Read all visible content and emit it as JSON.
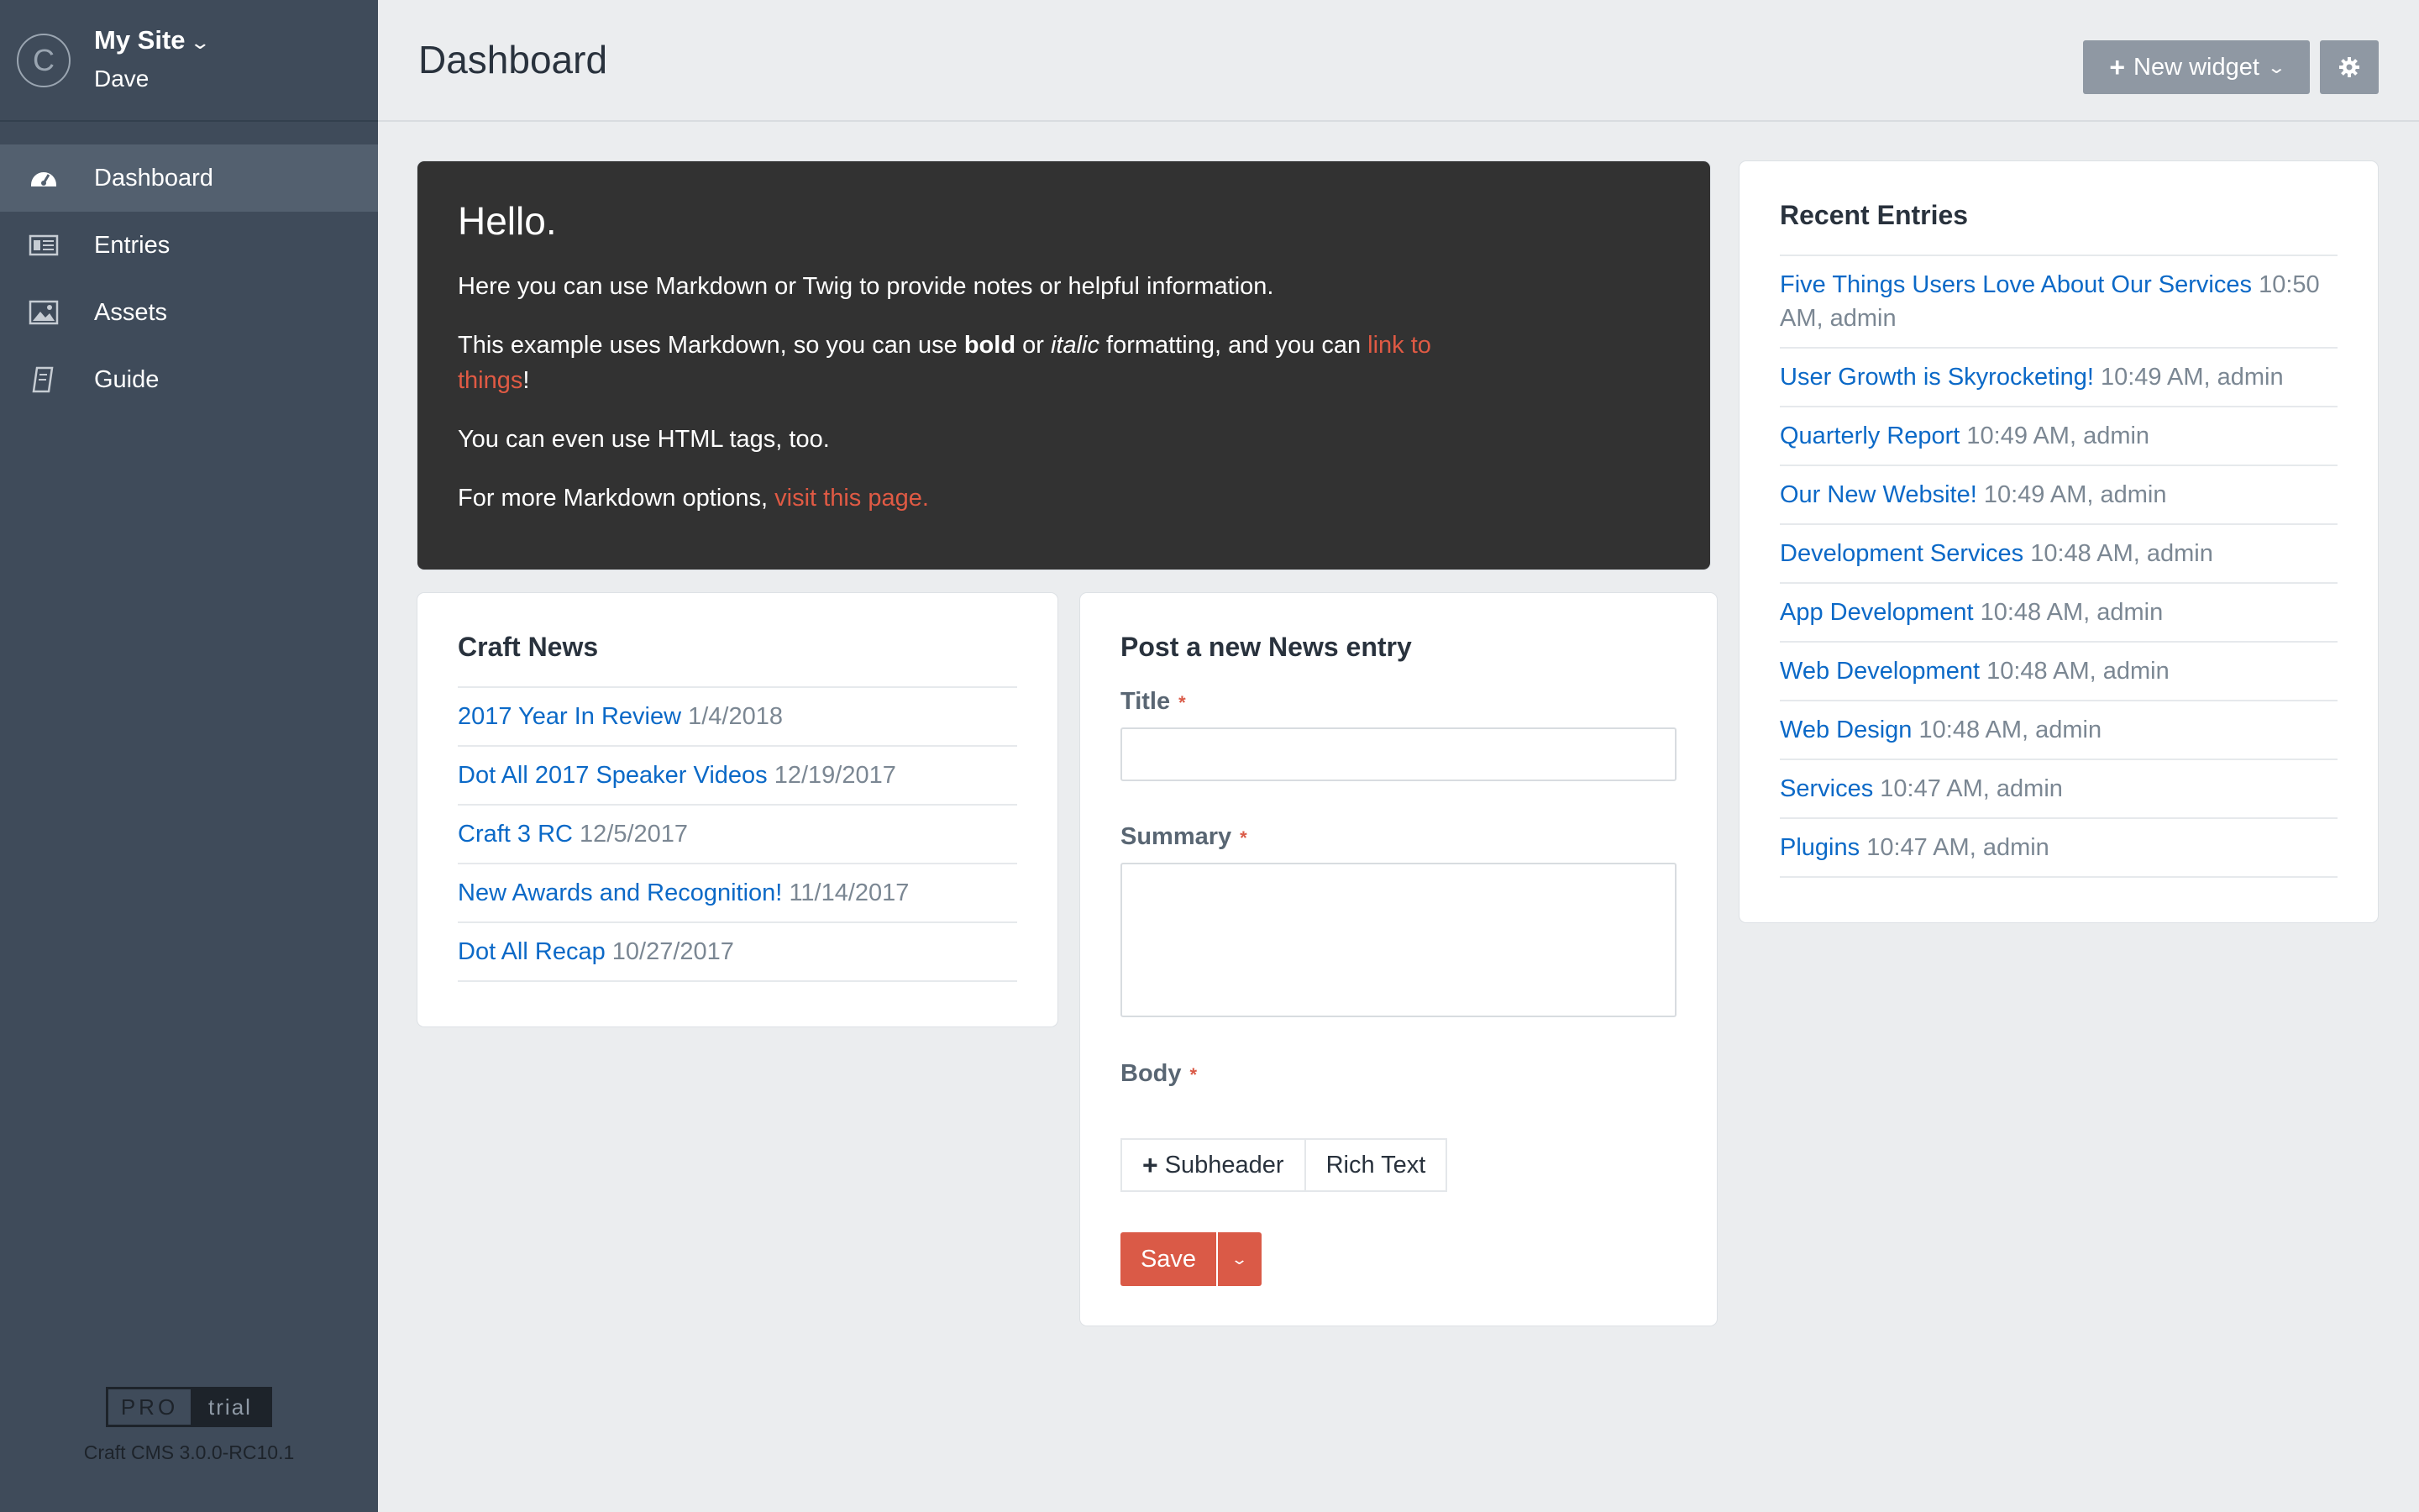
{
  "site": {
    "logo_letter": "C",
    "name": "My Site",
    "user": "Dave"
  },
  "nav": [
    {
      "label": "Dashboard",
      "icon": "dashboard-icon",
      "selected": true
    },
    {
      "label": "Entries",
      "icon": "entries-icon"
    },
    {
      "label": "Assets",
      "icon": "assets-icon"
    },
    {
      "label": "Guide",
      "icon": "guide-icon"
    }
  ],
  "edition": {
    "pro": "PRO",
    "trial": "trial",
    "version": "Craft CMS 3.0.0-RC10.1"
  },
  "header": {
    "title": "Dashboard",
    "new_widget_label": "New widget"
  },
  "hello_widget": {
    "heading": "Hello.",
    "p1": "Here you can use Markdown or Twig to provide notes or helpful information.",
    "p2_a": "This example uses Markdown, so you can use ",
    "p2_bold": "bold",
    "p2_or": " or ",
    "p2_italic": "italic",
    "p2_b": " formatting, and you can ",
    "p2_link": "link to things",
    "p2_end": "!",
    "p3": "You can even use HTML tags, too.",
    "p4_a": "For more Markdown options, ",
    "p4_link": "visit this page."
  },
  "craft_news": {
    "title": "Craft News",
    "items": [
      {
        "title": "2017 Year In Review",
        "date": "1/4/2018"
      },
      {
        "title": "Dot All 2017 Speaker Videos",
        "date": "12/19/2017"
      },
      {
        "title": "Craft 3 RC",
        "date": "12/5/2017"
      },
      {
        "title": "New Awards and Recognition!",
        "date": "11/14/2017"
      },
      {
        "title": "Dot All Recap",
        "date": "10/27/2017"
      }
    ]
  },
  "post_form": {
    "title": "Post a new News entry",
    "title_label": "Title",
    "summary_label": "Summary",
    "body_label": "Body",
    "required_mark": "*",
    "subheader_btn": "Subheader",
    "richtext_btn": "Rich Text",
    "save_label": "Save"
  },
  "recent_entries": {
    "title": "Recent Entries",
    "items": [
      {
        "title": "Five Things Users Love About Our Services",
        "meta": "10:50 AM, admin"
      },
      {
        "title": "User Growth is Skyrocketing!",
        "meta": "10:49 AM, admin"
      },
      {
        "title": "Quarterly Report",
        "meta": "10:49 AM, admin"
      },
      {
        "title": "Our New Website!",
        "meta": "10:49 AM, admin"
      },
      {
        "title": "Development Services",
        "meta": "10:48 AM, admin"
      },
      {
        "title": "App Development",
        "meta": "10:48 AM, admin"
      },
      {
        "title": "Web Development",
        "meta": "10:48 AM, admin"
      },
      {
        "title": "Web Design",
        "meta": "10:48 AM, admin"
      },
      {
        "title": "Services",
        "meta": "10:47 AM, admin"
      },
      {
        "title": "Plugins",
        "meta": "10:47 AM, admin"
      }
    ]
  },
  "colors": {
    "sidebar": "#3f4b5a",
    "link": "#0b69c7",
    "accent": "#da5a47"
  }
}
